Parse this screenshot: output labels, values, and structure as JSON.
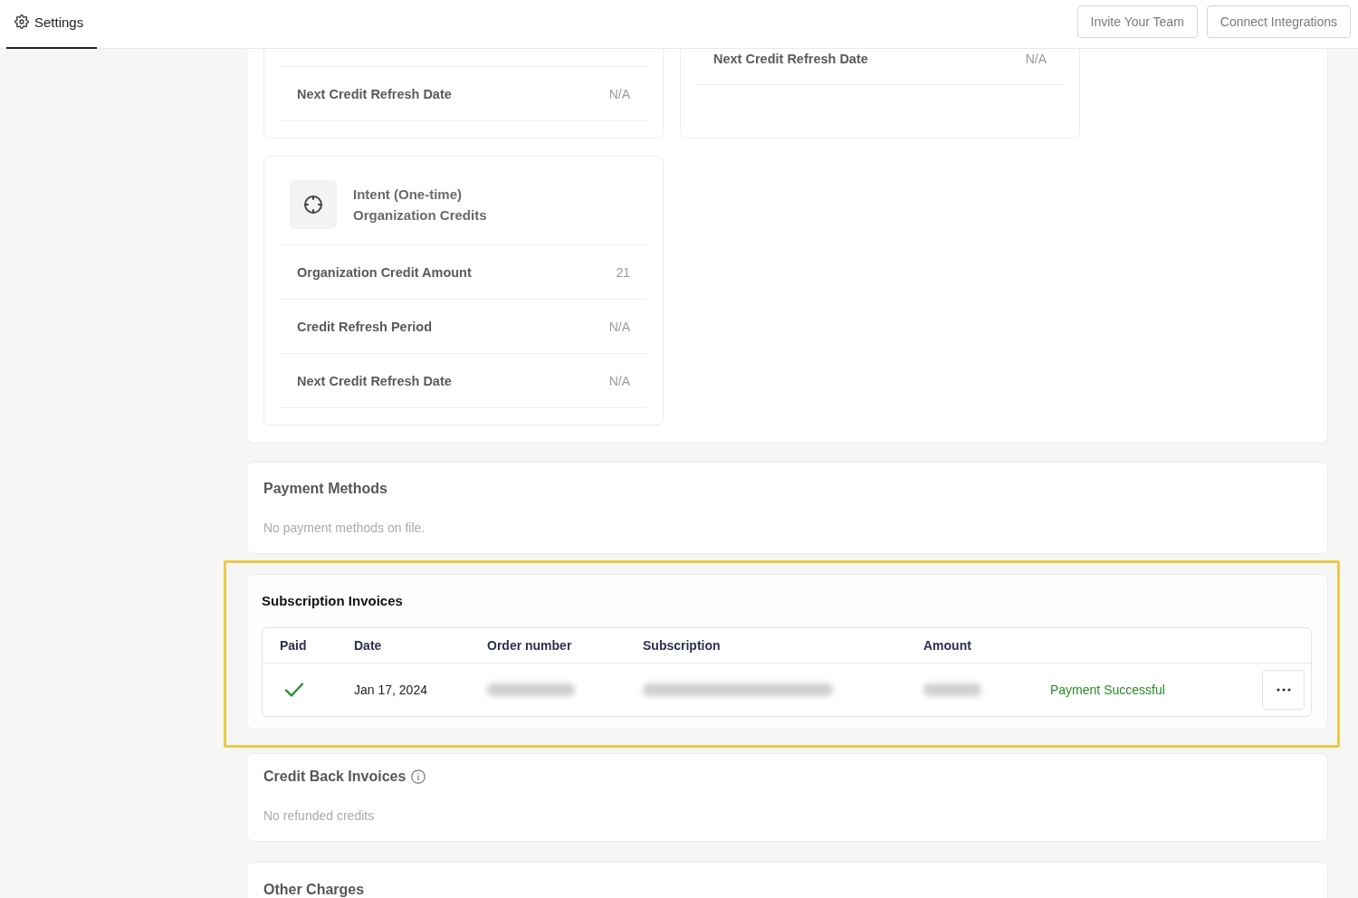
{
  "topbar": {
    "tab": {
      "label": "Settings",
      "selected": true
    },
    "buttons": [
      "Invite Your Team",
      "Connect Integrations"
    ]
  },
  "credit_cards": [
    {
      "rows": [
        {
          "label": "Next Credit Refresh Date",
          "value": "N/A"
        }
      ]
    },
    {
      "rows": [
        {
          "label": "Next Credit Refresh Date",
          "value": "N/A"
        }
      ]
    },
    {
      "title_lines": [
        "Intent (One-time)",
        "Organization Credits"
      ],
      "rows": [
        {
          "label": "Organization Credit Amount",
          "value": "21"
        },
        {
          "label": "Credit Refresh Period",
          "value": "N/A"
        },
        {
          "label": "Next Credit Refresh Date",
          "value": "N/A"
        }
      ]
    }
  ],
  "payment_methods": {
    "title": "Payment Methods",
    "message": "No payment methods on file."
  },
  "subscription_invoices": {
    "title": "Subscription Invoices",
    "highlighted": true,
    "table": {
      "columns": [
        "Paid",
        "Date",
        "Order number",
        "Subscription",
        "Amount"
      ],
      "rows": [
        {
          "paid": true,
          "date": "Jan 17, 2024",
          "status": "Payment Successful"
        }
      ]
    }
  },
  "credit_back_invoices": {
    "title": "Credit Back Invoices",
    "message": "No refunded credits"
  },
  "other_charges": {
    "title": "Other Charges"
  }
}
